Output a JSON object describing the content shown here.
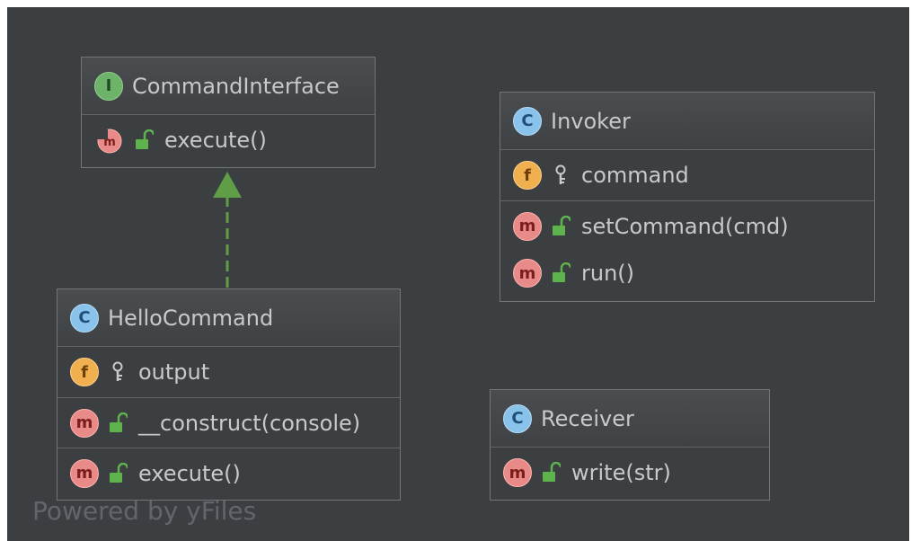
{
  "diagram": {
    "classes": [
      {
        "name": "CommandInterface",
        "kind_letter": "I",
        "sections": [
          [
            {
              "kind": "abstract-method",
              "visibility": "public",
              "label": "execute()"
            }
          ]
        ]
      },
      {
        "name": "Invoker",
        "kind_letter": "C",
        "sections": [
          [
            {
              "kind": "field",
              "kind_letter": "f",
              "visibility": "private",
              "label": "command"
            }
          ],
          [
            {
              "kind": "method",
              "kind_letter": "m",
              "visibility": "public",
              "label": "setCommand(cmd)"
            },
            {
              "kind": "method",
              "kind_letter": "m",
              "visibility": "public",
              "label": "run()"
            }
          ]
        ]
      },
      {
        "name": "HelloCommand",
        "kind_letter": "C",
        "sections": [
          [
            {
              "kind": "field",
              "kind_letter": "f",
              "visibility": "private",
              "label": "output"
            }
          ],
          [
            {
              "kind": "method",
              "kind_letter": "m",
              "visibility": "public",
              "label": "__construct(console)"
            }
          ],
          [
            {
              "kind": "method",
              "kind_letter": "m",
              "visibility": "public",
              "label": "execute()"
            }
          ]
        ]
      },
      {
        "name": "Receiver",
        "kind_letter": "C",
        "sections": [
          [
            {
              "kind": "method",
              "kind_letter": "m",
              "visibility": "public",
              "label": "write(str)"
            }
          ]
        ]
      }
    ],
    "relations": [
      {
        "type": "realization",
        "from": "HelloCommand",
        "to": "CommandInterface"
      }
    ],
    "watermark": "Powered by yFiles"
  },
  "colors": {
    "background": "#3c3f41",
    "interface_badge": "#6db46a",
    "class_badge": "#89c2ea",
    "field_badge": "#f0b04f",
    "method_badge": "#e88a87",
    "public_lock": "#5fb34d",
    "arrow": "#5f9e47"
  }
}
